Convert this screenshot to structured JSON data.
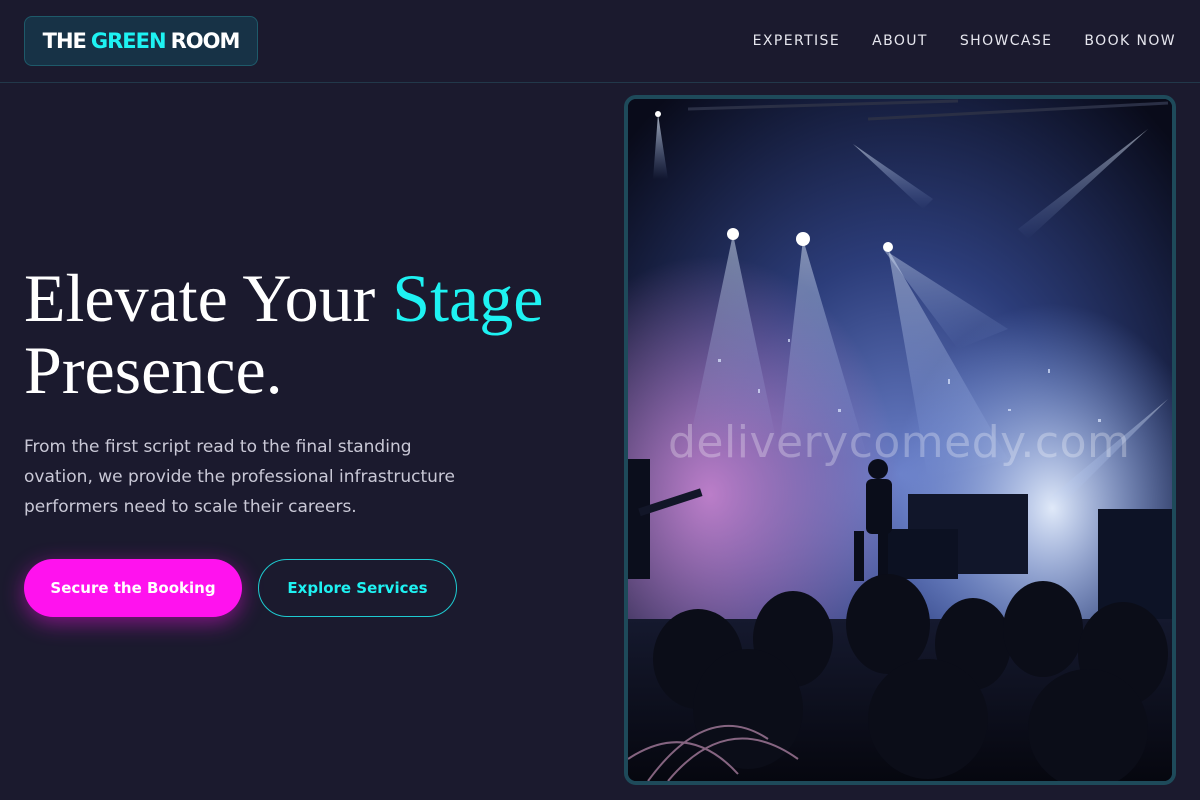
{
  "brand": {
    "part1": "THE",
    "part2": "GREEN",
    "part3": "ROOM",
    "accent_color": "#1ef2f2"
  },
  "nav": {
    "items": [
      "EXPERTISE",
      "ABOUT",
      "SHOWCASE",
      "BOOK NOW"
    ]
  },
  "hero": {
    "title_part1": "Elevate Your",
    "title_accent": "Stage",
    "title_part2": "Presence.",
    "subtitle": "From the first script read to the final standing ovation, we provide the professional infrastructure performers need to scale their careers.",
    "primary_cta": "Secure the Booking",
    "secondary_cta": "Explore Services",
    "primary_color": "#ff12ee"
  },
  "image": {
    "watermark": "deliverycomedy.com",
    "icon": "concert-stage-photo"
  }
}
